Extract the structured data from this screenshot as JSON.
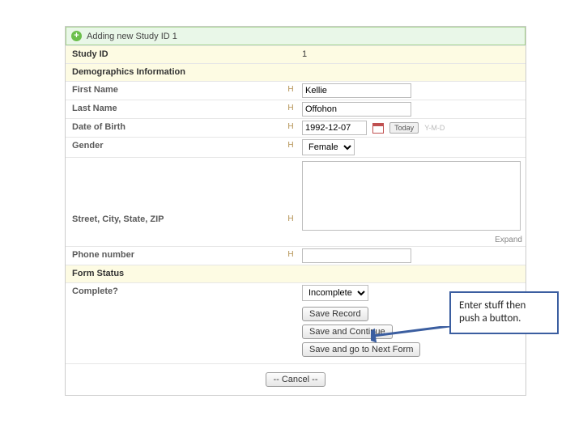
{
  "banner": {
    "title": "Adding new Study ID 1"
  },
  "sections": {
    "study_id": {
      "label": "Study ID",
      "value": "1"
    },
    "demo_header": "Demographics Information",
    "first_name": {
      "label": "First Name",
      "value": "Kellie"
    },
    "last_name": {
      "label": "Last Name",
      "value": "Offohon"
    },
    "dob": {
      "label": "Date of Birth",
      "value": "1992-12-07",
      "today": "Today",
      "hint": "Y-M-D"
    },
    "gender": {
      "label": "Gender",
      "selected": "Female"
    },
    "address": {
      "label": "Street, City, State, ZIP",
      "value": "",
      "expand": "Expand"
    },
    "phone": {
      "label": "Phone number",
      "value": ""
    },
    "form_status_header": "Form Status",
    "complete": {
      "label": "Complete?",
      "selected": "Incomplete"
    }
  },
  "buttons": {
    "save": "Save Record",
    "save_continue": "Save and Continue",
    "save_next": "Save and go to Next Form",
    "cancel": "-- Cancel --"
  },
  "history_mark": "H",
  "callout": {
    "line1": "Enter stuff then",
    "line2": "push a button."
  }
}
